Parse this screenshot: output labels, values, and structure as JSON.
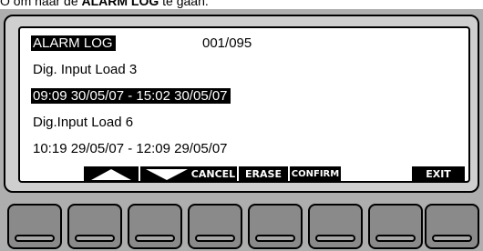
{
  "caption": {
    "before": "O om naar de ",
    "bold": "ALARM LOG",
    "after": " te gaan."
  },
  "screen": {
    "title": "ALARM LOG",
    "counter": "001/095",
    "entries": [
      {
        "name": "Dig. Input Load 3",
        "period": "09:09 30/05/07 - 15:02 30/05/07",
        "selected": true
      },
      {
        "name": "Dig.Input Load 6",
        "period": "10:19 29/05/07 - 12:09 29/05/07",
        "selected": false
      }
    ]
  },
  "softkeys": {
    "up_icon": "up-triangle-icon",
    "down_icon": "down-triangle-icon",
    "cancel": "CANCEL",
    "erase": "ERASE",
    "confirm": "CONFIRM",
    "exit": "EXIT"
  },
  "colors": {
    "lcd_background": "#ffffff",
    "lcd_foreground": "#000000",
    "device_body": "#aeaeae",
    "key_face": "#8a8a8a"
  },
  "hardware_keys": {
    "count": 8
  }
}
